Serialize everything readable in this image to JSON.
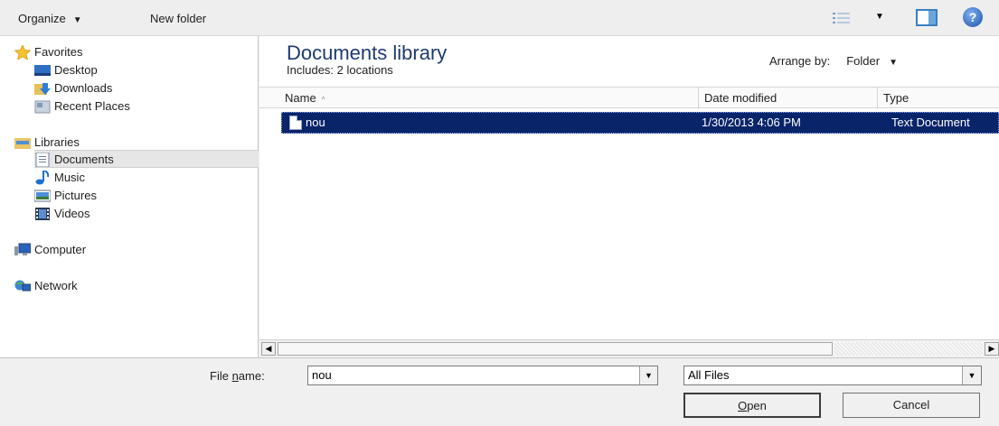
{
  "toolbar": {
    "organize_label": "Organize",
    "organize_caret": "▼",
    "new_folder_label": "New folder",
    "views_caret": "▼",
    "help_glyph": "?"
  },
  "nav": {
    "favorites": {
      "label": "Favorites",
      "icon": "star-icon"
    },
    "favorites_items": [
      {
        "label": "Desktop",
        "icon": "desktop-icon"
      },
      {
        "label": "Downloads",
        "icon": "downloads-icon"
      },
      {
        "label": "Recent Places",
        "icon": "recent-places-icon"
      }
    ],
    "libraries": {
      "label": "Libraries",
      "icon": "libraries-icon"
    },
    "libraries_items": [
      {
        "label": "Documents",
        "icon": "documents-icon",
        "selected": true
      },
      {
        "label": "Music",
        "icon": "music-icon"
      },
      {
        "label": "Pictures",
        "icon": "pictures-icon"
      },
      {
        "label": "Videos",
        "icon": "videos-icon"
      }
    ],
    "computer": {
      "label": "Computer",
      "icon": "computer-icon"
    },
    "network": {
      "label": "Network",
      "icon": "network-icon"
    }
  },
  "main": {
    "title": "Documents library",
    "subtitle": "Includes:  2 locations",
    "arrange_label": "Arrange by:",
    "arrange_value": "Folder",
    "arrange_caret": "▼",
    "columns": {
      "name": "Name",
      "name_sort_glyph": "^",
      "date": "Date modified",
      "type": "Type"
    },
    "rows": [
      {
        "name": "nou",
        "date": "1/30/2013 4:06 PM",
        "type": "Text Document",
        "selected": true
      }
    ]
  },
  "scrollbar": {
    "left_glyph": "◀",
    "right_glyph": "▶"
  },
  "footer": {
    "file_name_label_pre": "File ",
    "file_name_label_mnemonic": "n",
    "file_name_label_post": "ame:",
    "file_name_value": "nou",
    "file_type_value": "All Files",
    "dropdown_glyph": "▼",
    "open_label_mnemonic": "O",
    "open_label_rest": "pen",
    "cancel_label": "Cancel"
  },
  "colors": {
    "selection": "#0a246a",
    "title": "#1e3a6e"
  }
}
